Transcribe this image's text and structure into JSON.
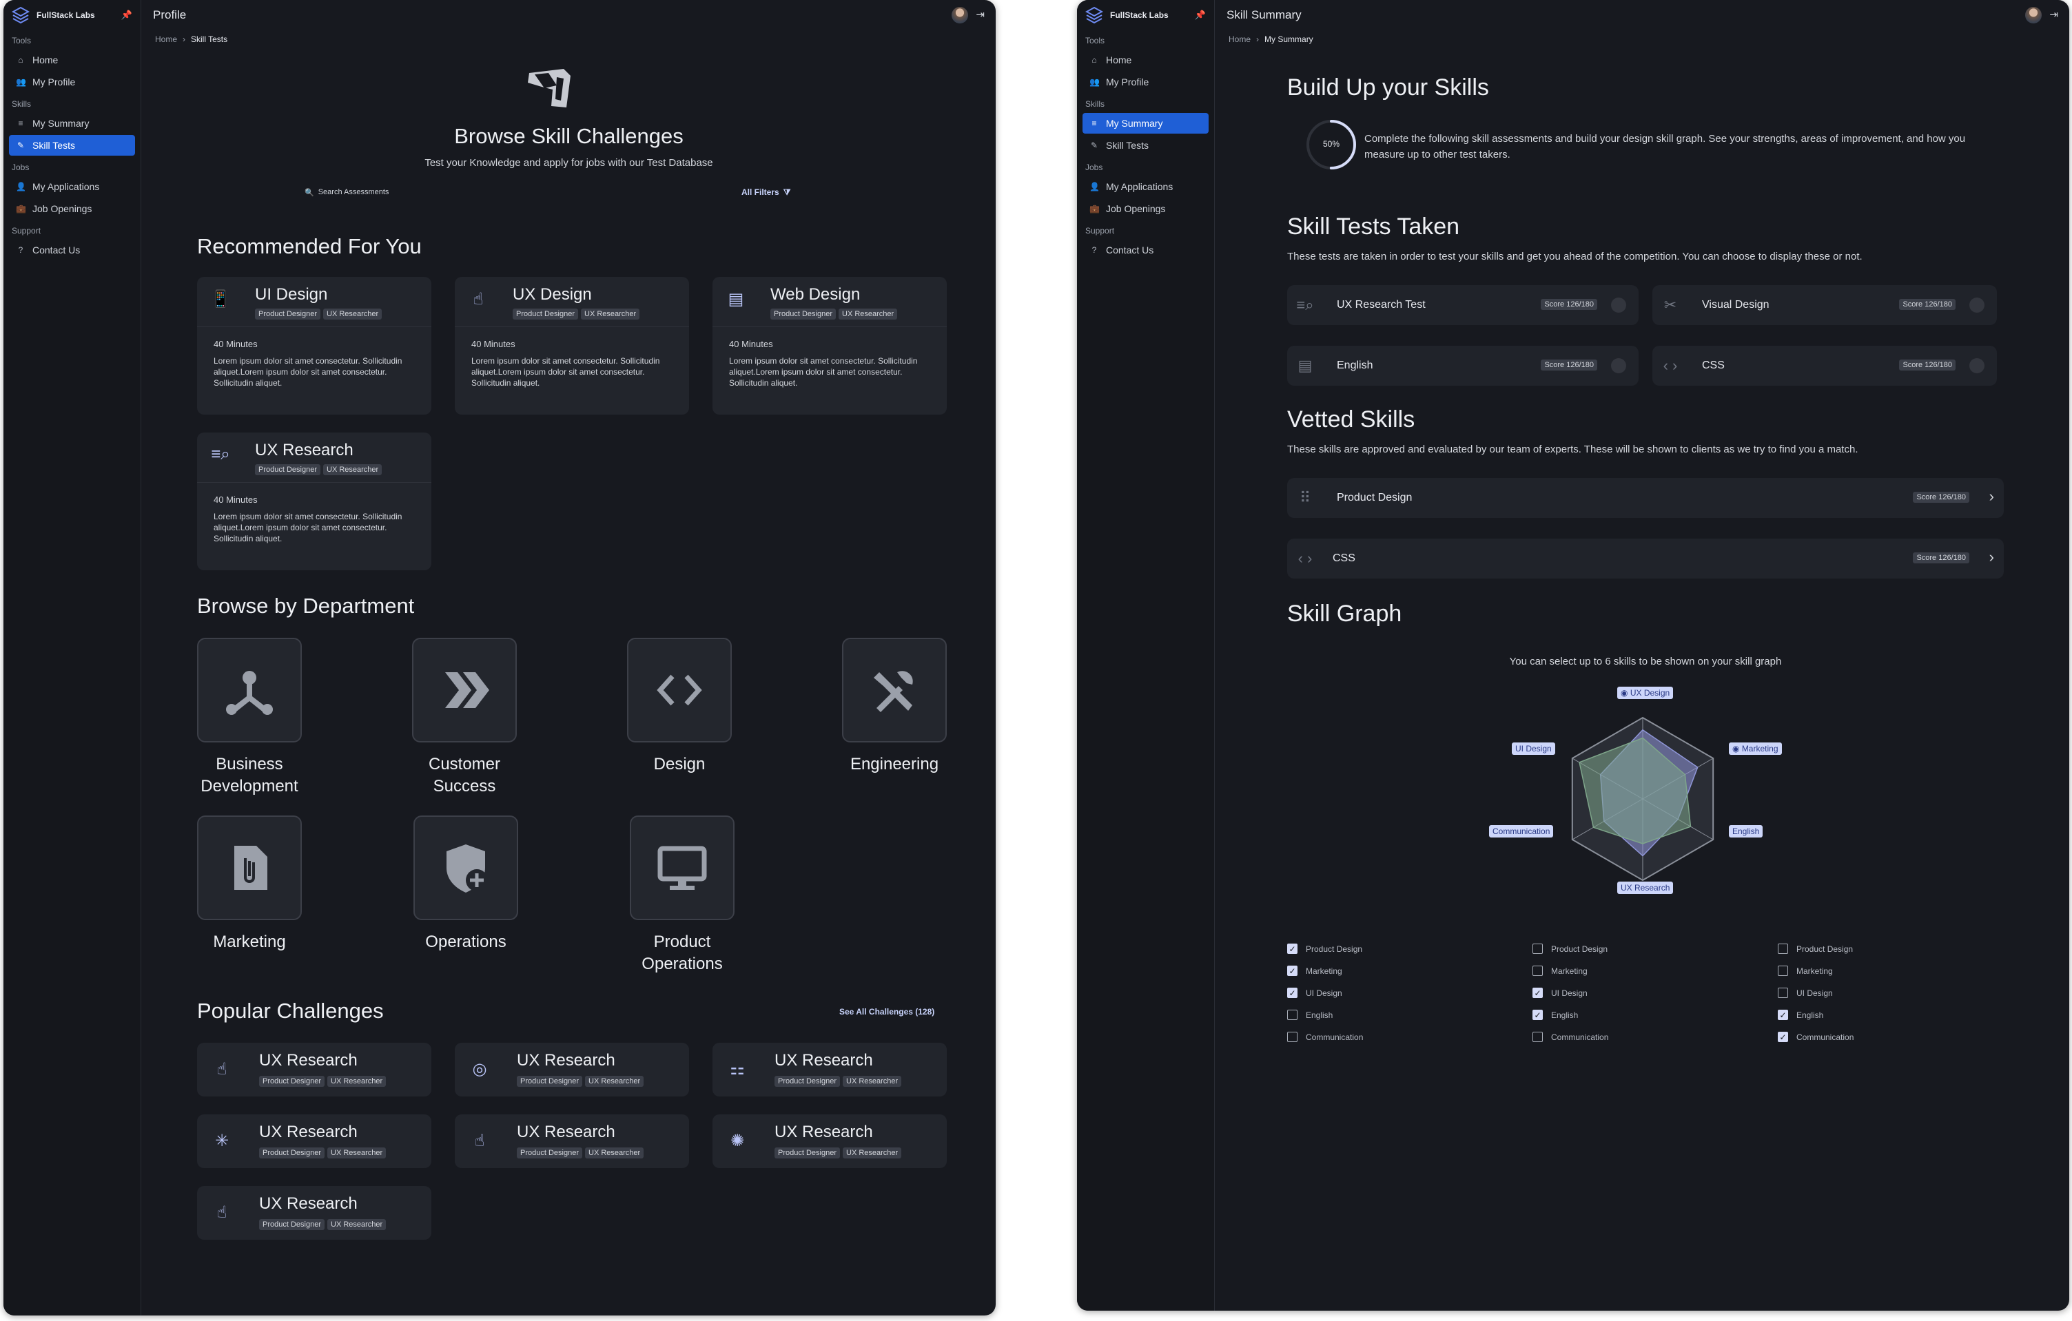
{
  "sidebar": {
    "brand": "FullStack Labs",
    "sections": {
      "tools": "Tools",
      "skills": "Skills",
      "jobs": "Jobs",
      "support": "Support"
    },
    "items": {
      "home": "Home",
      "profile": "My Profile",
      "summary": "My Summary",
      "tests": "Skill Tests",
      "applications": "My Applications",
      "openings": "Job Openings",
      "contact": "Contact Us"
    }
  },
  "left": {
    "title": "Profile",
    "breadcrumb": [
      "Home",
      "Skill Tests"
    ],
    "hero": {
      "title": "Browse Skill Challenges",
      "subtitle": "Test your Knowledge and apply for jobs with our Test Database",
      "search_placeholder": "Search Assessments",
      "filters": "All Filters"
    },
    "recommended": {
      "heading": "Recommended For You",
      "cards": [
        {
          "title": "UI Design",
          "tags": [
            "Product Designer",
            "UX Researcher"
          ],
          "minutes": "40 Minutes",
          "desc": "Lorem ipsum dolor sit amet consectetur. Sollicitudin aliquet.Lorem ipsum dolor sit amet consectetur. Sollicitudin aliquet."
        },
        {
          "title": "UX Design",
          "tags": [
            "Product Designer",
            "UX Researcher"
          ],
          "minutes": "40 Minutes",
          "desc": "Lorem ipsum dolor sit amet consectetur. Sollicitudin aliquet.Lorem ipsum dolor sit amet consectetur. Sollicitudin aliquet."
        },
        {
          "title": "Web Design",
          "tags": [
            "Product Designer",
            "UX Researcher"
          ],
          "minutes": "40 Minutes",
          "desc": "Lorem ipsum dolor sit amet consectetur. Sollicitudin aliquet.Lorem ipsum dolor sit amet consectetur. Sollicitudin aliquet."
        },
        {
          "title": "UX Research",
          "tags": [
            "Product Designer",
            "UX Researcher"
          ],
          "minutes": "40 Minutes",
          "desc": "Lorem ipsum dolor sit amet consectetur. Sollicitudin aliquet.Lorem ipsum dolor sit amet consectetur. Sollicitudin aliquet."
        }
      ]
    },
    "departments": {
      "heading": "Browse by Department",
      "items": [
        "Business Development",
        "Customer Success",
        "Design",
        "Engineering",
        "Marketing",
        "Operations",
        "Product Operations"
      ]
    },
    "popular": {
      "heading": "Popular Challenges",
      "see_all": "See All Challenges (128)",
      "items": [
        {
          "title": "UX Research",
          "tags": [
            "Product Designer",
            "UX Researcher"
          ]
        },
        {
          "title": "UX Research",
          "tags": [
            "Product Designer",
            "UX Researcher"
          ]
        },
        {
          "title": "UX Research",
          "tags": [
            "Product Designer",
            "UX Researcher"
          ]
        },
        {
          "title": "UX Research",
          "tags": [
            "Product Designer",
            "UX Researcher"
          ]
        },
        {
          "title": "UX Research",
          "tags": [
            "Product Designer",
            "UX Researcher"
          ]
        },
        {
          "title": "UX Research",
          "tags": [
            "Product Designer",
            "UX Researcher"
          ]
        },
        {
          "title": "UX Research",
          "tags": [
            "Product Designer",
            "UX Researcher"
          ]
        }
      ]
    }
  },
  "right": {
    "title": "Skill Summary",
    "breadcrumb": [
      "Home",
      "My Summary"
    ],
    "buildup": {
      "heading": "Build Up your Skills",
      "progress": "50%",
      "progress_value": 0.5,
      "text": "Complete the following skill assessments and build your design skill graph. See your strengths, areas of improvement, and how you measure up to other test takers."
    },
    "taken": {
      "heading": "Skill Tests Taken",
      "text": "These tests are taken in order to test your skills and get you ahead of the competition. You can choose to display these or not.",
      "items": [
        {
          "name": "UX Research Test",
          "score": "Score 126/180"
        },
        {
          "name": "Visual Design",
          "score": "Score 126/180"
        },
        {
          "name": "English",
          "score": "Score 126/180"
        },
        {
          "name": "CSS",
          "score": "Score 126/180"
        }
      ]
    },
    "vetted": {
      "heading": "Vetted Skills",
      "text": "These skills are approved and evaluated by our team of experts. These will be shown to clients as we try to find you a match.",
      "items": [
        {
          "name": "Product Design",
          "score": "Score 126/180"
        },
        {
          "name": "CSS",
          "score": "Score 126/180"
        }
      ]
    },
    "graph": {
      "heading": "Skill Graph",
      "hint": "You can select up to 6 skills to be shown on your skill graph",
      "axes": [
        "UX Design",
        "Marketing",
        "English",
        "UX Research",
        "Communication",
        "UI Design"
      ],
      "series": [
        {
          "values": [
            0.85,
            0.78,
            0.5,
            0.7,
            0.55,
            0.6
          ],
          "color": "#8f96d8"
        },
        {
          "values": [
            0.75,
            0.6,
            0.68,
            0.55,
            0.7,
            0.9
          ],
          "color": "#7ea58a"
        }
      ],
      "checklists": [
        {
          "items": [
            {
              "label": "Product Design",
              "checked": true
            },
            {
              "label": "Marketing",
              "checked": true
            },
            {
              "label": "UI Design",
              "checked": true
            },
            {
              "label": "English",
              "checked": false
            },
            {
              "label": "Communication",
              "checked": false
            }
          ]
        },
        {
          "items": [
            {
              "label": "Product Design",
              "checked": false
            },
            {
              "label": "Marketing",
              "checked": false
            },
            {
              "label": "UI Design",
              "checked": true
            },
            {
              "label": "English",
              "checked": true
            },
            {
              "label": "Communication",
              "checked": false
            }
          ]
        },
        {
          "items": [
            {
              "label": "Product Design",
              "checked": false
            },
            {
              "label": "Marketing",
              "checked": false
            },
            {
              "label": "UI Design",
              "checked": false
            },
            {
              "label": "English",
              "checked": true
            },
            {
              "label": "Communication",
              "checked": true
            }
          ]
        }
      ]
    }
  }
}
